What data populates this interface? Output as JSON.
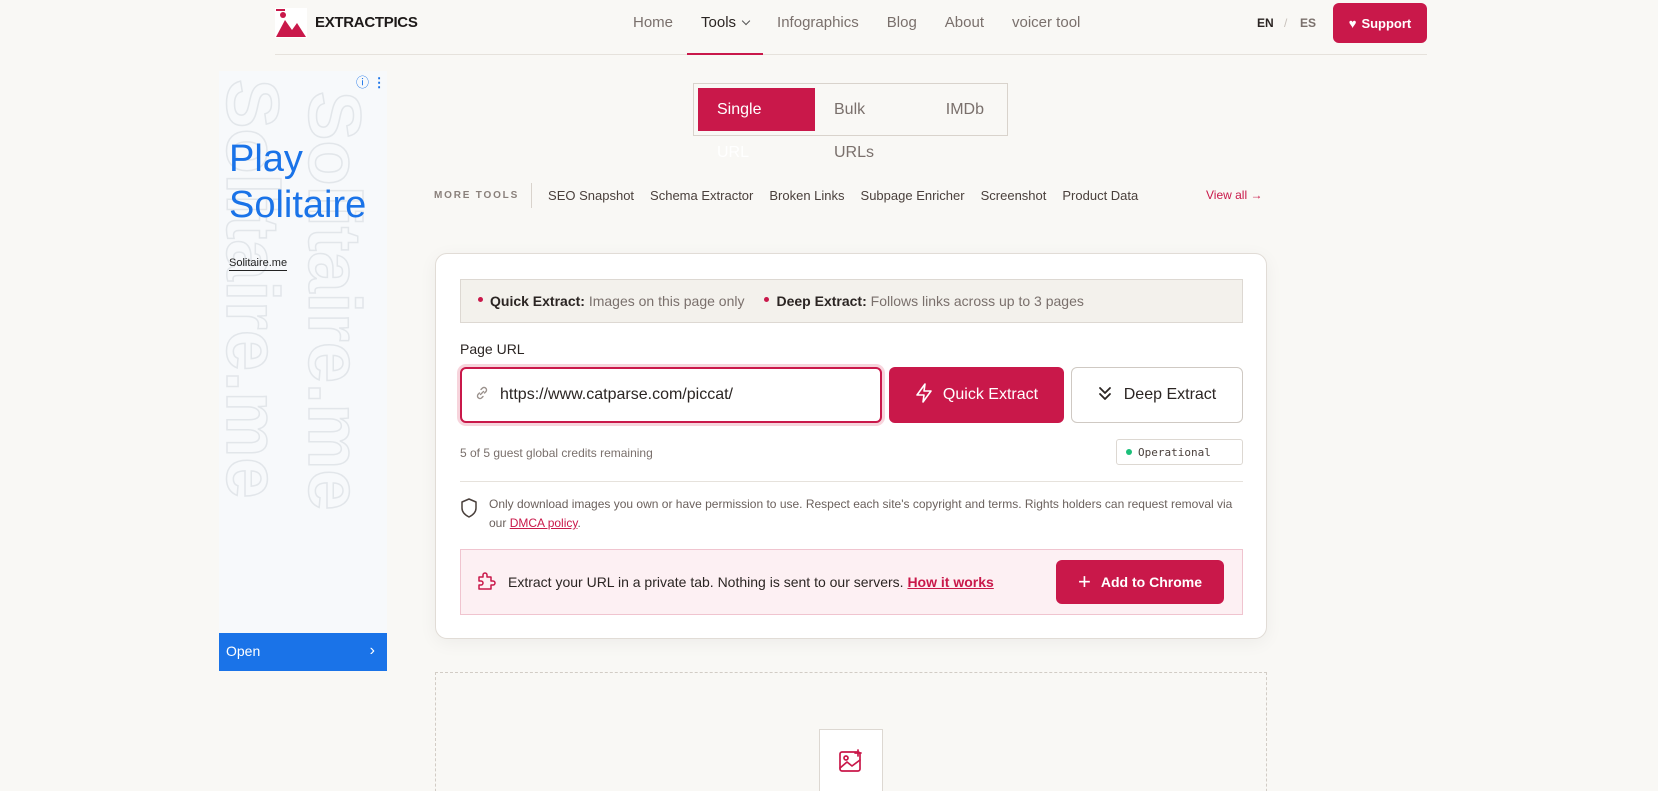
{
  "header": {
    "brand": "EXTRACTPICS",
    "nav": [
      {
        "label": "Home"
      },
      {
        "label": "Tools"
      },
      {
        "label": "Infographics"
      },
      {
        "label": "Blog"
      },
      {
        "label": "About"
      },
      {
        "label": "voicer tool"
      }
    ],
    "lang_en": "EN",
    "lang_sep": "/",
    "lang_es": "ES",
    "support": "Support"
  },
  "ad": {
    "bg_text_1": "Solitaire.me",
    "bg_text_2": "Solitaire.me",
    "title": "Play Solitaire",
    "domain": "Solitaire.me",
    "open": "Open"
  },
  "modes": [
    "Single URL",
    "Bulk URLs",
    "IMDb"
  ],
  "more_tools": {
    "label": "MORE TOOLS",
    "items": [
      "SEO Snapshot",
      "Schema Extractor",
      "Broken Links",
      "Subpage Enricher",
      "Screenshot",
      "Product Data"
    ],
    "view_all": "View all →"
  },
  "card": {
    "quick_label": "Quick Extract:",
    "quick_desc": "Images on this page only",
    "deep_label": "Deep Extract:",
    "deep_desc": "Follows links across up to 3 pages",
    "field_label": "Page URL",
    "url_value": "https://www.catparse.com/piccat/",
    "btn_quick": "Quick Extract",
    "btn_deep": "Deep Extract",
    "credits": "5 of 5 guest global credits remaining",
    "status": "Operational",
    "notice_text": "Only download images you own or have permission to use. Respect each site's copyright and terms. Rights holders can request removal via our",
    "notice_link": "DMCA policy",
    "notice_end": ".",
    "private_text": "Extract your URL in a private tab. Nothing is sent to our servers.",
    "private_link": "How it works",
    "chrome_btn": "Add to Chrome"
  },
  "colors": {
    "accent": "#c9184a",
    "ad_blue": "#1a73e8",
    "status_green": "#1bbf7a"
  }
}
